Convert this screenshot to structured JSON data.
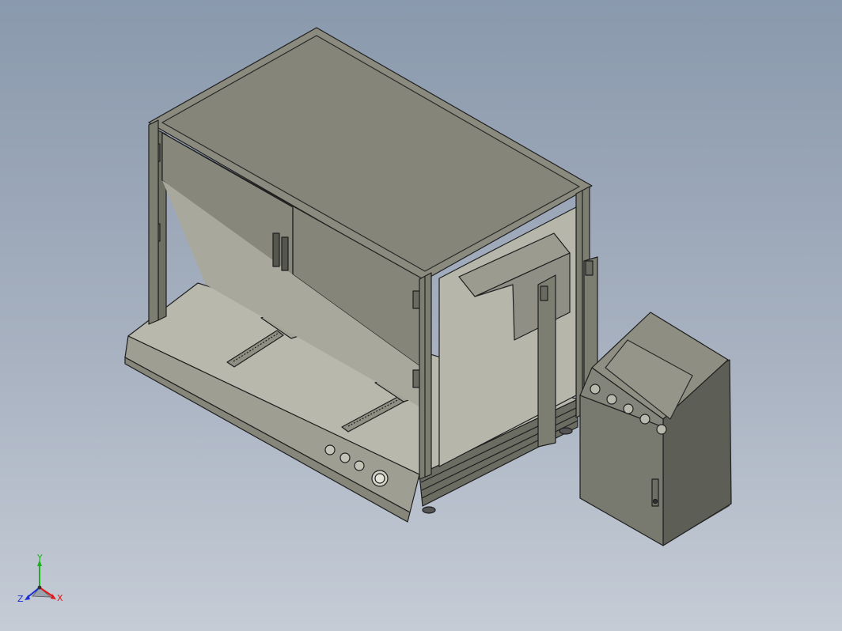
{
  "view": {
    "background_top": "#8a99ad",
    "background_bottom": "#c5ccd6"
  },
  "model": {
    "frame_color": "#7d7e72",
    "panel_color": "#85857a",
    "edge_color": "#1e1e1e"
  },
  "triad": {
    "x_label": "X",
    "y_label": "Y",
    "z_label": "Z",
    "x_color": "#e01818",
    "y_color": "#1fb01f",
    "z_color": "#1a2fd6"
  }
}
